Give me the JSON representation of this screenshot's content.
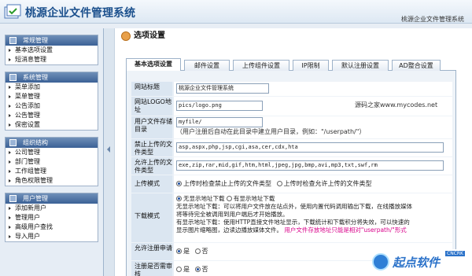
{
  "app": {
    "title": "桃源企业文件管理系统",
    "brand": "桃源企业文件管理系统"
  },
  "section": {
    "title": "选项设置"
  },
  "tabs": [
    "基本选项设置",
    "邮件设置",
    "上传组件设置",
    "IP限制",
    "默认注册设置",
    "AD整合设置"
  ],
  "sidebar": [
    {
      "title": "常规管理",
      "items": [
        "基本选项设置",
        "短消息管理"
      ]
    },
    {
      "title": "系统管理",
      "items": [
        "菜单添加",
        "菜单管理",
        "公告添加",
        "公告管理",
        "保密设置"
      ]
    },
    {
      "title": "组织结构",
      "items": [
        "公司管理",
        "部门管理",
        "工作组管理",
        "角色权限管理"
      ]
    },
    {
      "title": "用户管理",
      "items": [
        "添加新用户",
        "管理用户",
        "高级用户查找",
        "导入用户"
      ]
    }
  ],
  "form": {
    "site_title": {
      "label": "网站标题",
      "value": "桃源企业文件管理系统"
    },
    "logo": {
      "label": "网站LOGO地址",
      "value": "pics/logo.png",
      "note": "源码之家www.mycodes.net"
    },
    "user_dir": {
      "label": "用户文件存储目录",
      "value": "myfile/",
      "note": "（用户注册后自动在此目录中建立用户目录，例如：\"/userpath/\"）"
    },
    "forbidden": {
      "label": "禁止上传的文件类型",
      "value": "asp,aspx,php,jsp,cgi,asa,cer,cdx,hta"
    },
    "allowed": {
      "label": "允许上传的文件类型",
      "value": "exe,zip,rar,mid,gif,htm,html,jpeg,jpg,bmp,avi,mp3,txt,swf,rm"
    },
    "upload_mode": {
      "label": "上传模式",
      "opt1": "上传时检查禁止上传的文件类型",
      "opt2": "上传时检查允许上传的文件类型"
    },
    "download_mode": {
      "label": "下载模式",
      "opt1": "无显示地址下载",
      "opt2": "有显示地址下载",
      "desc1": "无显示地址下载：可以将用户文件放在站点外，使用内置代码调用输出下载，在线播放媒体",
      "desc2": "将等待完全被调用到用户端后才开始播放。",
      "desc3": "有显示地址下载：使用HTTP直接文件地址显示，下载统计和下载积分将失效，可以快速的",
      "desc4": "显示图片缩略图，边读边播放媒体文件。",
      "pink": "用户文件存放地址只能是相对\"userpath/\"形式"
    },
    "allow_register": {
      "label": "允许注册申请",
      "yes": "是",
      "no": "否"
    },
    "need_review": {
      "label": "注册是否需审核",
      "yes": "是",
      "no": "否"
    }
  },
  "watermark": {
    "text": "起点软件",
    "sub": "CNCRK"
  }
}
